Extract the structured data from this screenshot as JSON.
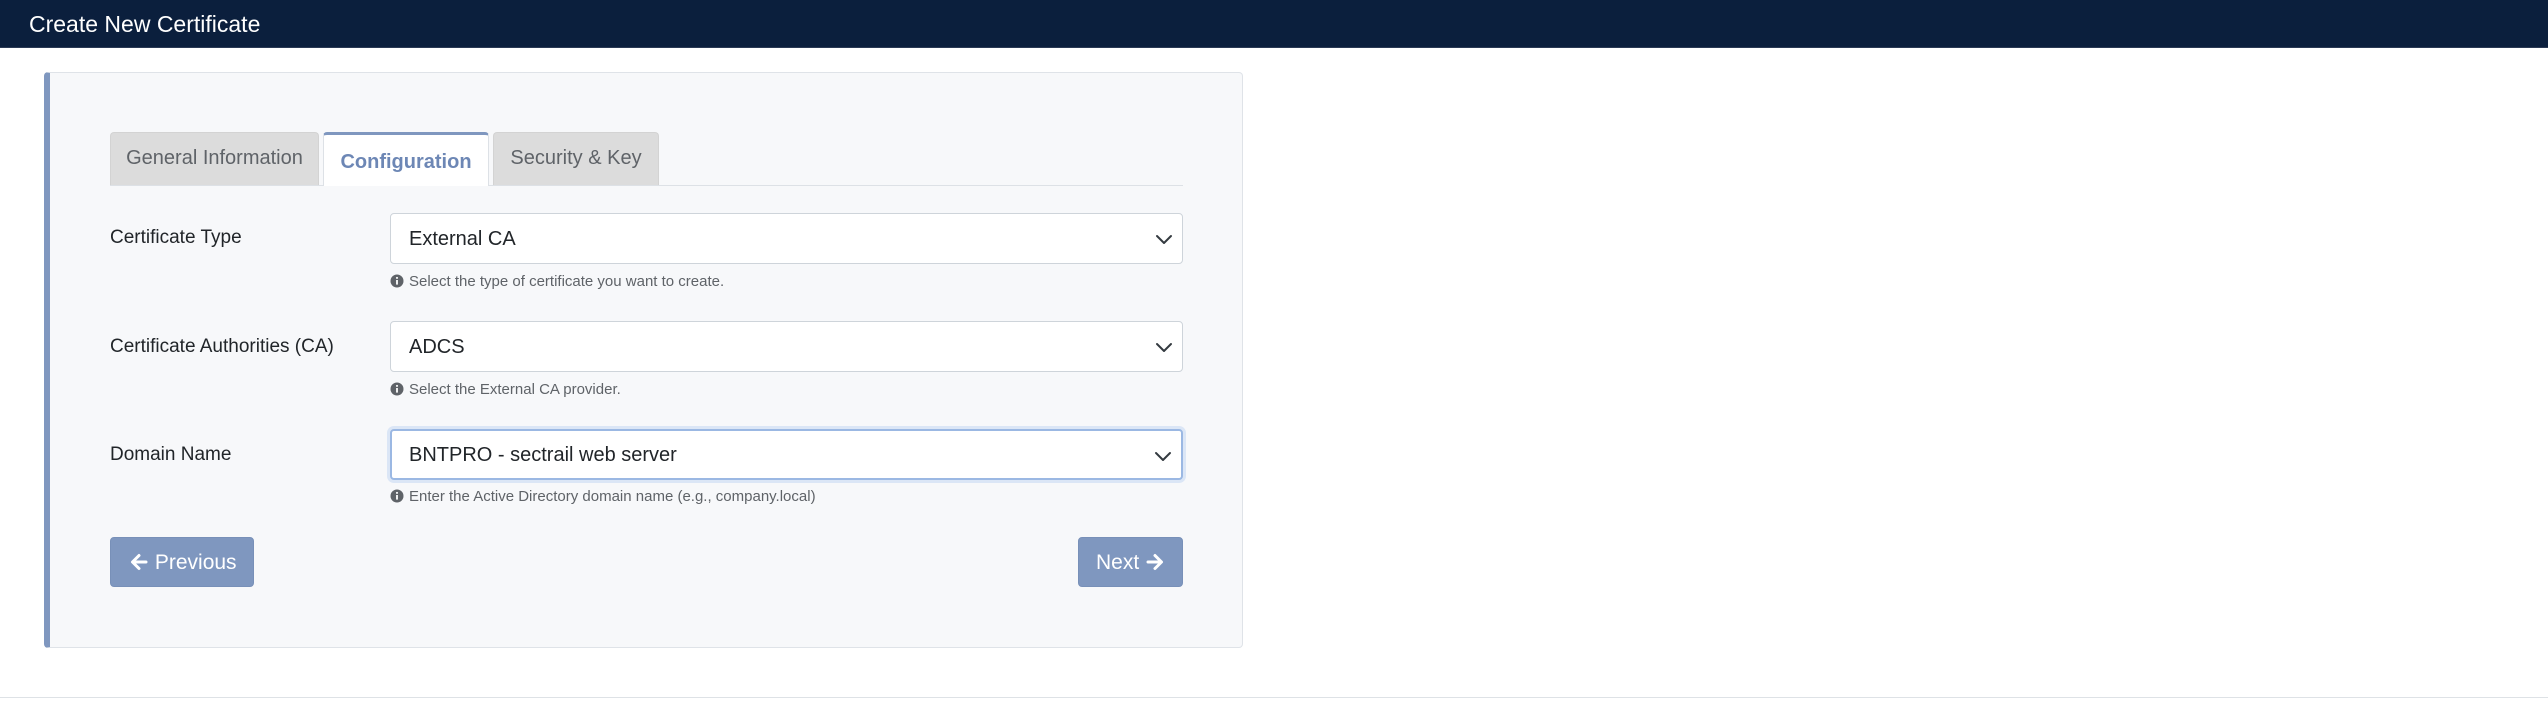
{
  "header": {
    "title": "Create New Certificate"
  },
  "tabs": [
    {
      "label": "General Information",
      "active": false
    },
    {
      "label": "Configuration",
      "active": true
    },
    {
      "label": "Security & Key",
      "active": false
    }
  ],
  "fields": {
    "certificate_type": {
      "label": "Certificate Type",
      "value": "External CA",
      "help": "Select the type of certificate you want to create."
    },
    "certificate_authority": {
      "label": "Certificate Authorities (CA)",
      "value": "ADCS",
      "help": "Select the External CA provider."
    },
    "domain_name": {
      "label": "Domain Name",
      "value": "BNTPRO - sectrail web server",
      "help": "Enter the Active Directory domain name (e.g., company.local)"
    }
  },
  "buttons": {
    "previous_label": "Previous",
    "next_label": "Next"
  },
  "icons": {
    "dropdown": "chevron-down-icon",
    "help": "info-circle-icon",
    "previous": "arrow-left-icon",
    "next": "arrow-right-icon"
  },
  "colors": {
    "header_bg": "#0b1f3d",
    "accent": "#7f97bf",
    "active_tab_text": "#6d87b5",
    "card_bg": "#f7f8fa"
  }
}
